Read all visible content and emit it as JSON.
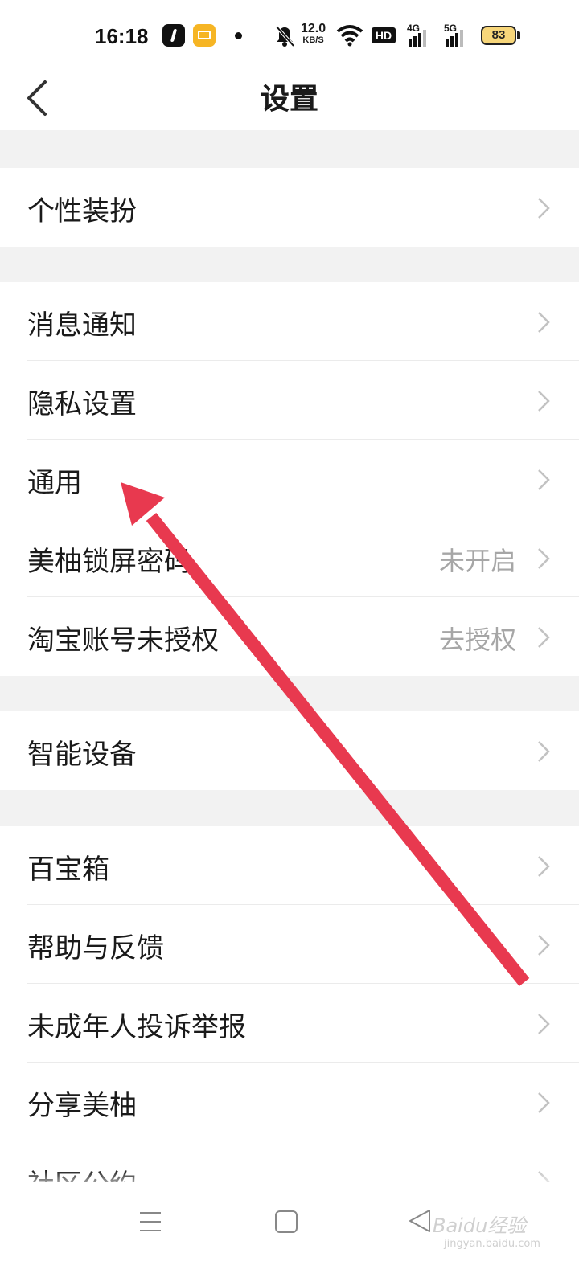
{
  "status_bar": {
    "time": "16:18",
    "net_speed_value": "12.0",
    "net_speed_unit": "KB/S",
    "hd_label": "HD",
    "signal_4g": "4G",
    "signal_5g": "5G",
    "battery": "83",
    "icons": [
      "app-icon",
      "mail-icon",
      "notification-dot",
      "bell-off-icon",
      "wifi-icon",
      "hd-icon",
      "signal-4g-icon",
      "signal-5g-icon",
      "battery-icon"
    ]
  },
  "header": {
    "title": "设置",
    "back_icon": "chevron-left-icon"
  },
  "settings": {
    "personalize": {
      "label": "个性装扮"
    },
    "notifications": {
      "label": "消息通知"
    },
    "privacy": {
      "label": "隐私设置"
    },
    "general": {
      "label": "通用"
    },
    "lock_password": {
      "label": "美柚锁屏密码",
      "value": "未开启"
    },
    "taobao": {
      "label": "淘宝账号未授权",
      "value": "去授权"
    },
    "smart_devices": {
      "label": "智能设备"
    },
    "toolbox": {
      "label": "百宝箱"
    },
    "help": {
      "label": "帮助与反馈"
    },
    "minor_report": {
      "label": "未成年人投诉举报"
    },
    "share": {
      "label": "分享美柚"
    },
    "community": {
      "label": "社区公约"
    }
  },
  "nav": {
    "icons": [
      "menu-icon",
      "home-square-icon",
      "back-triangle-icon"
    ]
  },
  "watermark": {
    "text": "Baidu经验",
    "url": "jingyan.baidu.com"
  },
  "colors": {
    "page_bg": "#f2f2f2",
    "row_bg": "#ffffff",
    "secondary_text": "#a6a6a6",
    "annotation_arrow": "#e8394f"
  }
}
